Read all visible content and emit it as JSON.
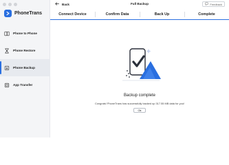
{
  "app": {
    "name": "PhoneTrans",
    "accent_color": "#2a6fe0"
  },
  "sidebar": {
    "items": [
      {
        "label": "Phone to Phone",
        "icon": "phone-to-phone-icon",
        "active": false
      },
      {
        "label": "Phone Restore",
        "icon": "hourglass-icon",
        "active": false
      },
      {
        "label": "Phone Backup",
        "icon": "backup-icon",
        "active": true
      },
      {
        "label": "App Transfer",
        "icon": "app-transfer-icon",
        "active": false
      }
    ]
  },
  "header": {
    "back_label": "Back",
    "title": "Full Backup",
    "feedback_label": "Feedback"
  },
  "steps": {
    "items": [
      "Connect Device",
      "Confirm Data",
      "Back Up",
      "Complete"
    ],
    "progress": 1.0
  },
  "result": {
    "title": "Backup complete",
    "message": "Congrats! PhoneTrans has successfully backed up 317.55 MB data for you!",
    "ok_label": "Ok"
  }
}
